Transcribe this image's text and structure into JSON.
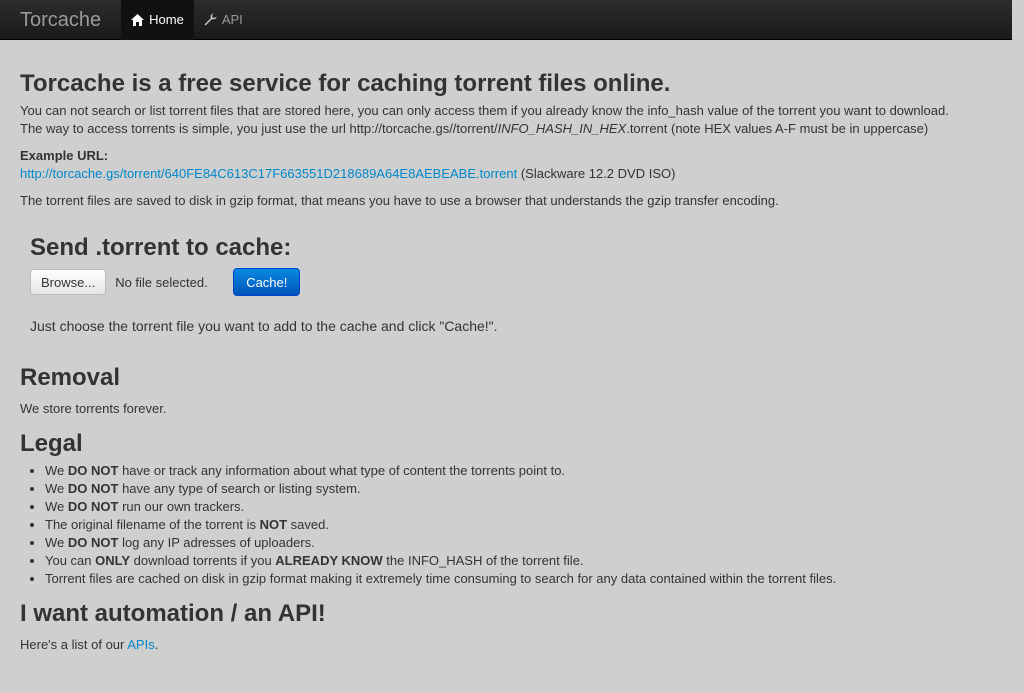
{
  "nav": {
    "brand": "Torcache",
    "items": [
      {
        "label": "Home",
        "icon": "home-icon",
        "active": true
      },
      {
        "label": "API",
        "icon": "wrench-icon",
        "active": false
      }
    ]
  },
  "main": {
    "title": "Torcache is a free service for caching torrent files online.",
    "intro_line1": "You can not search or list torrent files that are stored here, you can only access them if you already know the info_hash value of the torrent you want to download.",
    "intro_line2_prefix": "The way to access torrents is simple, you just use the url http://torcache.gs//torrent/",
    "intro_line2_em": "INFO_HASH_IN_HEX",
    "intro_line2_suffix": ".torrent (note HEX values A-F must be in uppercase)",
    "example_label": "Example URL:",
    "example_link": "http://torcache.gs/torrent/640FE84C613C17F663551D218689A64E8AEBEABE.torrent",
    "example_note": " (Slackware 12.2 DVD ISO)",
    "gzip_note": "The torrent files are saved to disk in gzip format, that means you have to use a browser that understands the gzip transfer encoding."
  },
  "upload": {
    "title": "Send .torrent to cache:",
    "browse_label": "Browse...",
    "file_status": "No file selected.",
    "cache_label": "Cache!",
    "hint": "Just choose the torrent file you want to add to the cache and click \"Cache!\"."
  },
  "removal": {
    "title": "Removal",
    "text": "We store torrents forever."
  },
  "legal": {
    "title": "Legal",
    "items": [
      {
        "a": "We ",
        "b": "DO NOT",
        "c": " have or track any information about what type of content the torrents point to.",
        "d": "",
        "e": ""
      },
      {
        "a": "We ",
        "b": "DO NOT",
        "c": " have any type of search or listing system.",
        "d": "",
        "e": ""
      },
      {
        "a": "We ",
        "b": "DO NOT",
        "c": " run our own trackers.",
        "d": "",
        "e": ""
      },
      {
        "a": "The original filename of the torrent is ",
        "b": "NOT",
        "c": " saved.",
        "d": "",
        "e": ""
      },
      {
        "a": "We ",
        "b": "DO NOT",
        "c": " log any IP adresses of uploaders.",
        "d": "",
        "e": ""
      },
      {
        "a": "You can ",
        "b": "ONLY",
        "c": " download torrents if you ",
        "d": "ALREADY KNOW",
        "e": " the INFO_HASH of the torrent file."
      },
      {
        "a": "Torrent files are cached on disk in gzip format making it extremely time consuming to search for any data contained within the torrent files.",
        "b": "",
        "c": "",
        "d": "",
        "e": ""
      }
    ]
  },
  "api": {
    "title": "I want automation / an API!",
    "text_prefix": "Here's a list of our ",
    "link": "APIs",
    "text_suffix": "."
  }
}
